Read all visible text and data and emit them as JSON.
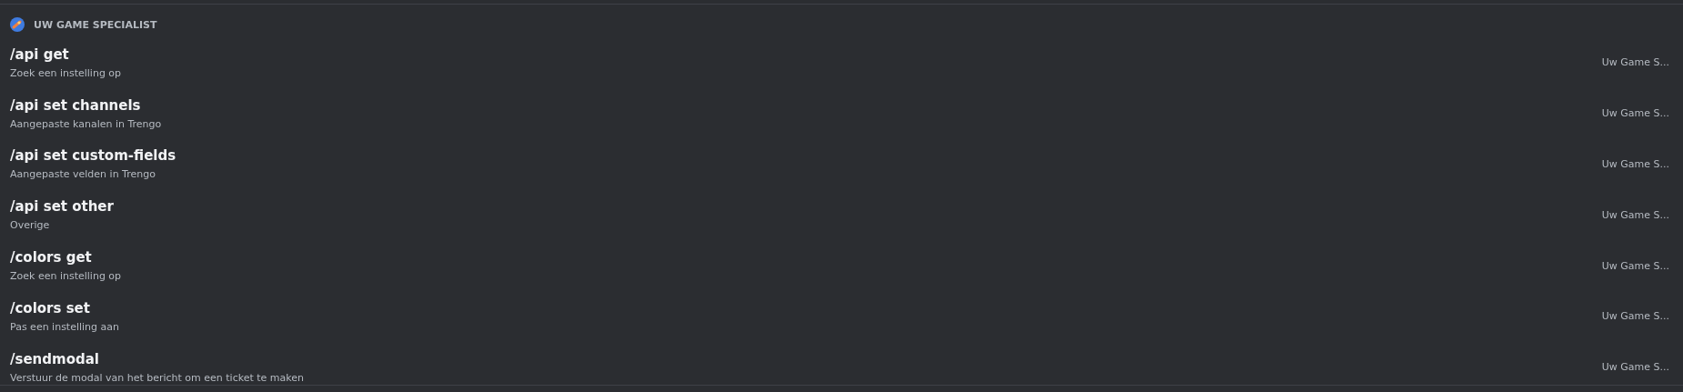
{
  "section": {
    "title": "UW GAME SPECIALIST"
  },
  "commands": [
    {
      "name": "/api get",
      "description": "Zoek een instelling op",
      "source": "Uw Game S..."
    },
    {
      "name": "/api set channels",
      "description": "Aangepaste kanalen in Trengo",
      "source": "Uw Game S..."
    },
    {
      "name": "/api set custom-fields",
      "description": "Aangepaste velden in Trengo",
      "source": "Uw Game S..."
    },
    {
      "name": "/api set other",
      "description": "Overige",
      "source": "Uw Game S..."
    },
    {
      "name": "/colors get",
      "description": "Zoek een instelling op",
      "source": "Uw Game S..."
    },
    {
      "name": "/colors set",
      "description": "Pas een instelling aan",
      "source": "Uw Game S..."
    },
    {
      "name": "/sendmodal",
      "description": "Verstuur de modal van het bericht om een ticket te maken",
      "source": "Uw Game S..."
    }
  ]
}
